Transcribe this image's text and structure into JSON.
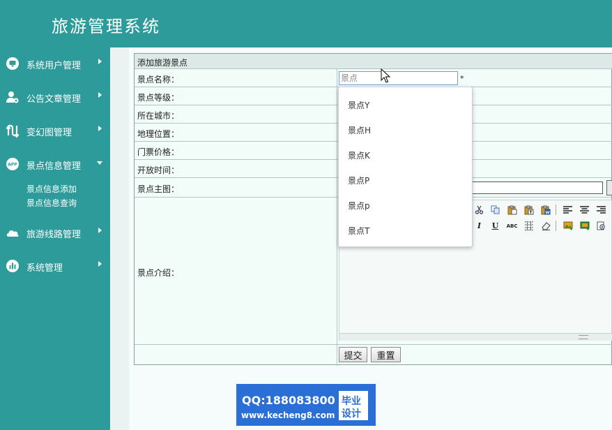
{
  "header": {
    "title": "旅游管理系统"
  },
  "sidebar": {
    "items": [
      {
        "label": "系统用户管理",
        "icon": "monitor-icon"
      },
      {
        "label": "公告文章管理",
        "icon": "user-gear-icon"
      },
      {
        "label": "变幻图管理",
        "icon": "transform-icon"
      },
      {
        "label": "景点信息管理",
        "icon": "app-icon",
        "expanded": true,
        "subitems": [
          {
            "label": "景点信息添加"
          },
          {
            "label": "景点信息查询"
          }
        ]
      },
      {
        "label": "旅游线路管理",
        "icon": "cloud-icon"
      },
      {
        "label": "系统管理",
        "icon": "bar-chart-icon"
      }
    ]
  },
  "form": {
    "caption": "添加旅游景点",
    "rows": [
      {
        "label": "景点名称："
      },
      {
        "label": "景点等级："
      },
      {
        "label": "所在城市："
      },
      {
        "label": "地理位置："
      },
      {
        "label": "门票价格："
      },
      {
        "label": "开放时间："
      },
      {
        "label": "景点主图："
      },
      {
        "label": "景点介绍："
      }
    ],
    "name_input": {
      "value": "",
      "placeholder": "景点"
    },
    "required_mark": "*",
    "submit_label": "提交",
    "reset_label": "重置"
  },
  "autocomplete": {
    "options": [
      "景点Y",
      "景点H",
      "景点K",
      "景点P",
      "景点p",
      "景点T"
    ]
  },
  "editor": {
    "toolbar_row1": [
      "cut-icon",
      "copy-icon",
      "paste-icon",
      "paste-text-icon",
      "paste-word-icon",
      "align-left-icon",
      "align-center-icon",
      "align-right-icon"
    ],
    "toolbar_row2": [
      "italic-icon",
      "underline-icon",
      "strikethrough-icon",
      "table-icon",
      "eraser-icon",
      "insert-image-icon",
      "insert-media-icon",
      "link-icon"
    ],
    "italic": "I",
    "underline": "U",
    "strike": "ABC"
  },
  "watermark": {
    "qq": "QQ:188083800",
    "url": "www.kecheng8.com",
    "badge_line1": "毕业",
    "badge_line2": "设计"
  },
  "colors": {
    "brand": "#2e9b9b",
    "panel": "#f2fcf9",
    "watermark": "#2a6fd6"
  }
}
